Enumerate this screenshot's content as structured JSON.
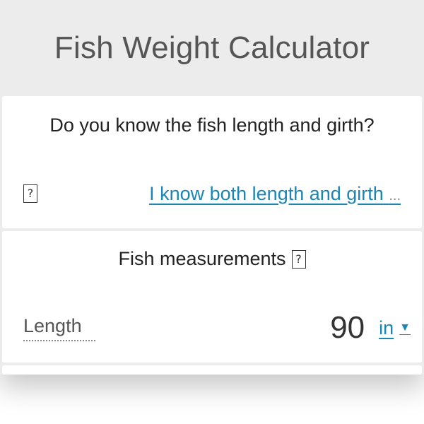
{
  "header": {
    "title": "Fish Weight Calculator"
  },
  "section_known": {
    "question": "Do you know the fish length and girth?",
    "info_glyph": "?",
    "selected_option": "I know both length and girth",
    "overflow_indicator": "..."
  },
  "section_measurements": {
    "title": "Fish measurements",
    "info_glyph": "?",
    "length": {
      "label": "Length",
      "value": "90",
      "unit": "in",
      "unit_caret": "▼"
    }
  }
}
